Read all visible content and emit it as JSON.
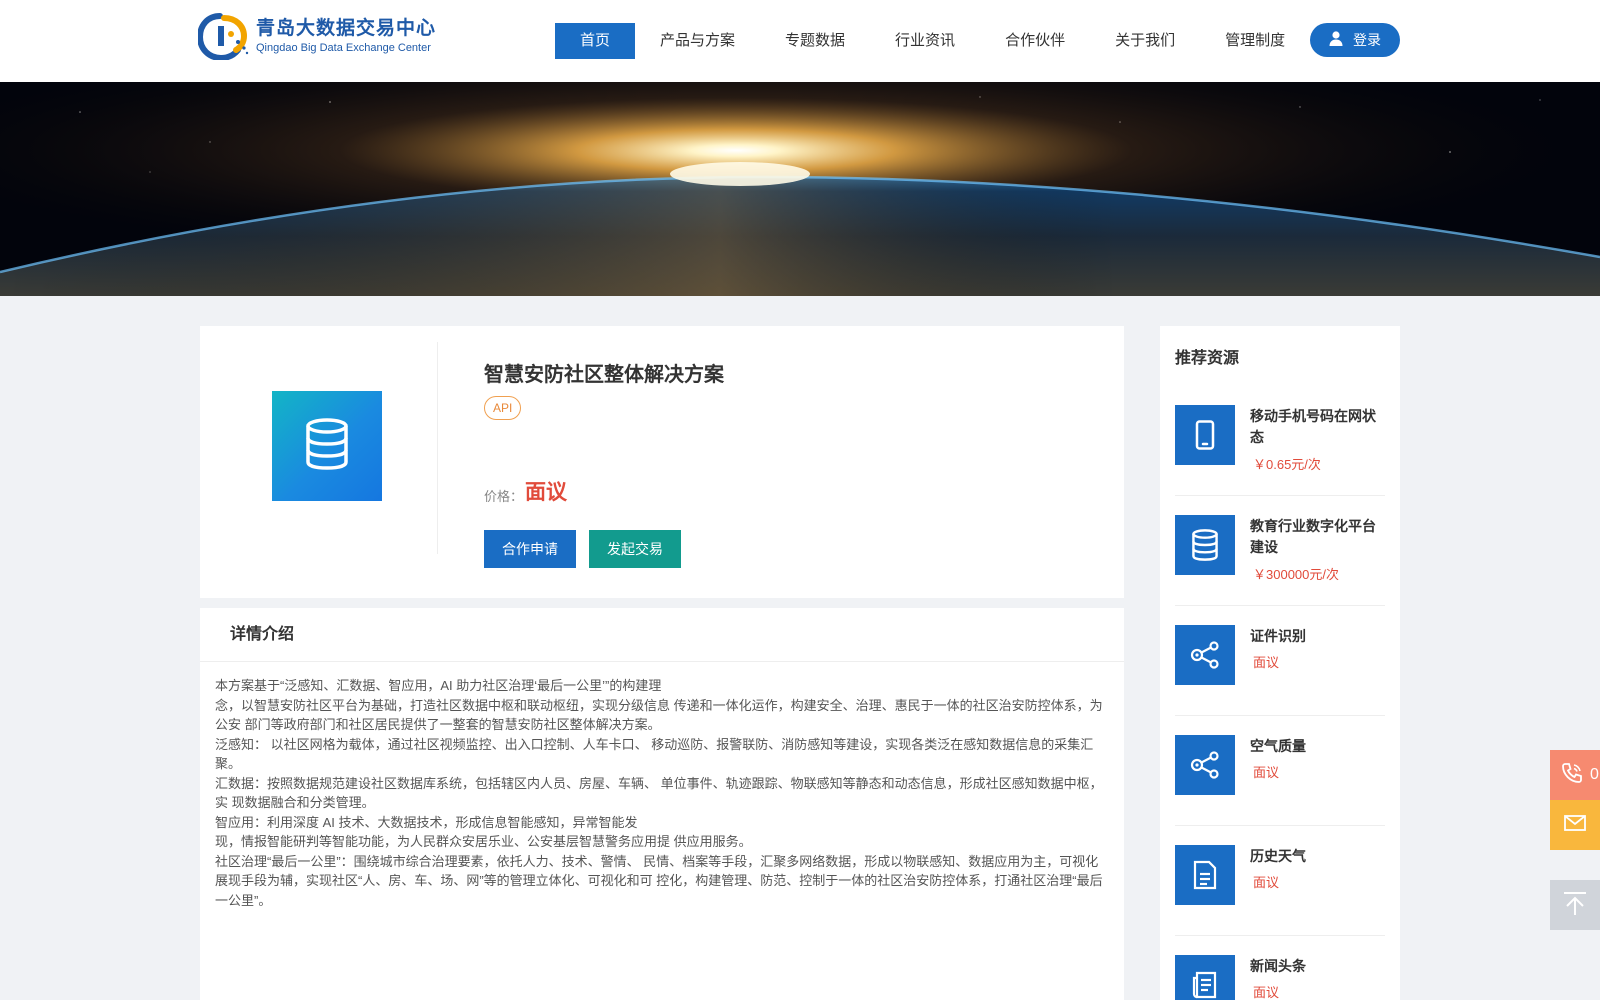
{
  "brand": {
    "name_cn": "青岛大数据交易中心",
    "name_en": "Qingdao Big Data Exchange Center"
  },
  "nav": {
    "items": [
      {
        "label": "首页",
        "active": true
      },
      {
        "label": "产品与方案",
        "active": false
      },
      {
        "label": "专题数据",
        "active": false
      },
      {
        "label": "行业资讯",
        "active": false
      },
      {
        "label": "合作伙伴",
        "active": false
      },
      {
        "label": "关于我们",
        "active": false
      },
      {
        "label": "管理制度",
        "active": false
      }
    ],
    "login_label": "登录"
  },
  "product": {
    "title": "智慧安防社区整体解决方案",
    "tag": "API",
    "price_label": "价格：",
    "price_value": "面议",
    "btn_cooperate": "合作申请",
    "btn_trade": "发起交易"
  },
  "detail": {
    "heading": "详情介绍",
    "paragraphs": [
      "本方案基于“泛感知、汇数据、智应用，AI 助力社区治理‘最后一公里’”的构建理",
      "念，以智慧安防社区平台为基础，打造社区数据中枢和联动枢纽，实现分级信息 传递和一体化运作，构建安全、治理、惠民于一体的社区治安防控体系，为公安 部门等政府部门和社区居民提供了一整套的智慧安防社区整体解决方案。",
      "泛感知： 以社区网格为载体，通过社区视频监控、出入口控制、人车卡口、 移动巡防、报警联防、消防感知等建设，实现各类泛在感知数据信息的采集汇聚。",
      "汇数据：按照数据规范建设社区数据库系统，包括辖区内人员、房屋、车辆、 单位事件、轨迹跟踪、物联感知等静态和动态信息，形成社区感知数据中枢，实 现数据融合和分类管理。",
      "智应用：利用深度 AI 技术、大数据技术，形成信息智能感知，异常智能发",
      "现，情报智能研判等智能功能，为人民群众安居乐业、公安基层智慧警务应用提 供应用服务。",
      "社区治理“最后一公里”：围绕城市综合治理要素，依托人力、技术、警情、 民情、档案等手段，汇聚多网络数据，形成以物联感知、数据应用为主，可视化展现手段为辅，实现社区“人、房、车、场、网”等的管理立体化、可视化和可 控化，构建管理、防范、控制于一体的社区治安防控体系，打通社区治理“最后一公里”。"
    ]
  },
  "sidebar": {
    "title": "推荐资源",
    "items": [
      {
        "name": "移动手机号码在网状态",
        "price": "￥0.65元/次",
        "icon": "mobile-phone-icon"
      },
      {
        "name": "教育行业数字化平台建设",
        "price": "￥300000元/次",
        "icon": "database-icon"
      },
      {
        "name": "证件识别",
        "price": "面议",
        "icon": "share-nodes-icon"
      },
      {
        "name": "空气质量",
        "price": "面议",
        "icon": "share-nodes-icon"
      },
      {
        "name": "历史天气",
        "price": "面议",
        "icon": "document-icon"
      },
      {
        "name": "新闻头条",
        "price": "面议",
        "icon": "news-icon"
      }
    ]
  },
  "floating": {
    "phone_glyph": "0"
  },
  "colors": {
    "primary": "#1a6dc4",
    "teal": "#129b8e",
    "price_red": "#e14b3b",
    "tag_orange": "#e8893a",
    "float_phone": "#f68a70",
    "float_mail": "#f9b73d"
  }
}
